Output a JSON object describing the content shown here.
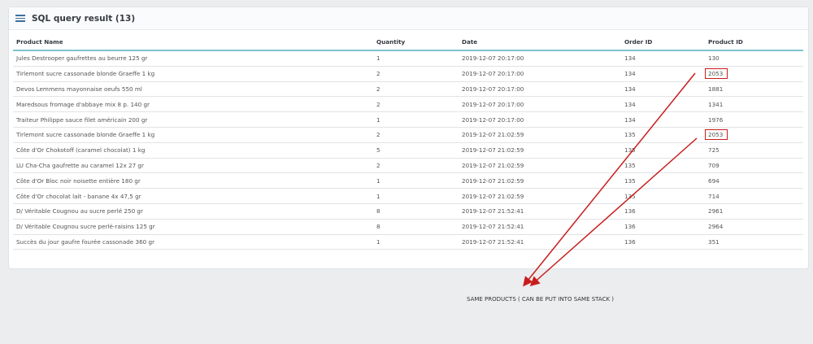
{
  "panel": {
    "title": "SQL query result (13)",
    "icon": "list-icon"
  },
  "table": {
    "columns": [
      "Product Name",
      "Quantity",
      "Date",
      "Order ID",
      "Product ID"
    ],
    "rows": [
      [
        "Jules Destrooper gaufrettes au beurre 125 gr",
        "1",
        "2019-12-07 20:17:00",
        "134",
        "130"
      ],
      [
        "Tirlemont sucre cassonade blonde Graeffe 1 kg",
        "2",
        "2019-12-07 20:17:00",
        "134",
        "2053"
      ],
      [
        "Devos Lemmens mayonnaise oeufs 550 ml",
        "2",
        "2019-12-07 20:17:00",
        "134",
        "1881"
      ],
      [
        "Maredsous fromage d'abbaye mix 8 p. 140 gr",
        "2",
        "2019-12-07 20:17:00",
        "134",
        "1341"
      ],
      [
        "Traiteur Philippe sauce filet américain 200 gr",
        "1",
        "2019-12-07 20:17:00",
        "134",
        "1976"
      ],
      [
        "Tirlemont sucre cassonade blonde Graeffe 1 kg",
        "2",
        "2019-12-07 21:02:59",
        "135",
        "2053"
      ],
      [
        "Côte d'Or Chokotoff (caramel chocolat) 1 kg",
        "5",
        "2019-12-07 21:02:59",
        "135",
        "725"
      ],
      [
        "LU Cha-Cha gaufrette au caramel 12x 27 gr",
        "2",
        "2019-12-07 21:02:59",
        "135",
        "709"
      ],
      [
        "Côte d'Or Bloc noir noisette entière 180 gr",
        "1",
        "2019-12-07 21:02:59",
        "135",
        "694"
      ],
      [
        "Côte d'Or chocolat lait - banane 4x 47,5 gr",
        "1",
        "2019-12-07 21:02:59",
        "135",
        "714"
      ],
      [
        "D/ Véritable Cougnou au sucre perlé 250 gr",
        "8",
        "2019-12-07 21:52:41",
        "136",
        "2961"
      ],
      [
        "D/ Véritable Cougnou sucre perlé-raisins 125 gr",
        "8",
        "2019-12-07 21:52:41",
        "136",
        "2964"
      ],
      [
        "Succès du jour gaufre fourée cassonade 360 gr",
        "1",
        "2019-12-07 21:52:41",
        "136",
        "351"
      ]
    ],
    "highlighted_rows": [
      1,
      5
    ]
  },
  "annotation": {
    "text": "SAME PRODUCTS ( CAN BE PUT INTO SAME STACK )",
    "color": "#c81d1d"
  },
  "accent": "#7cc4cd"
}
